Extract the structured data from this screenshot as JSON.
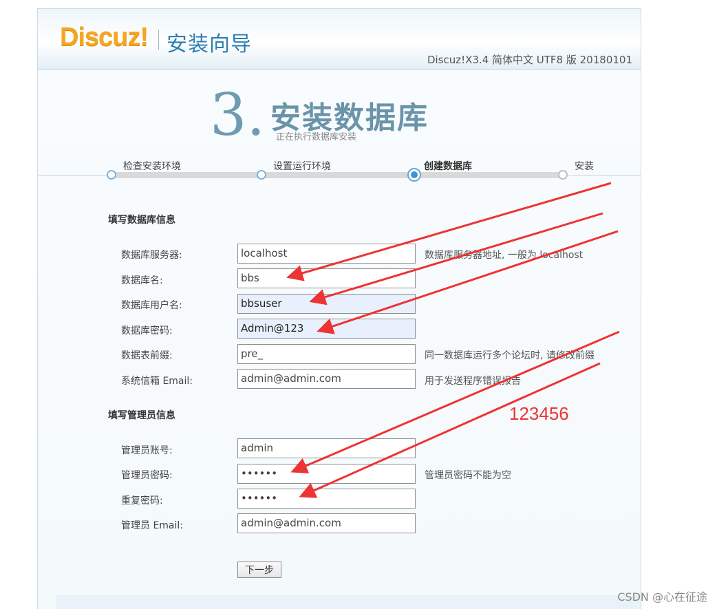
{
  "header": {
    "logo": "Discuz!",
    "title": "安装向导",
    "version": "Discuz!X3.4 简体中文 UTF8 版 20180101"
  },
  "step": {
    "number": "3.",
    "title": "安装数据库",
    "subtitle": "正在执行数据库安装"
  },
  "progress": {
    "steps": [
      "检查安装环境",
      "设置运行环境",
      "创建数据库",
      "安装"
    ],
    "current_index": 2
  },
  "db_section": {
    "title": "填写数据库信息",
    "rows": [
      {
        "label": "数据库服务器:",
        "value": "localhost",
        "hint": "数据库服务器地址, 一般为 localhost"
      },
      {
        "label": "数据库名:",
        "value": "bbs",
        "hint": ""
      },
      {
        "label": "数据库用户名:",
        "value": "bbsuser",
        "hint": ""
      },
      {
        "label": "数据库密码:",
        "value": "Admin@123",
        "hint": ""
      },
      {
        "label": "数据表前缀:",
        "value": "pre_",
        "hint": "同一数据库运行多个论坛时, 请修改前缀"
      },
      {
        "label": "系统信箱 Email:",
        "value": "admin@admin.com",
        "hint": "用于发送程序错误报告"
      }
    ]
  },
  "admin_section": {
    "title": "填写管理员信息",
    "rows": [
      {
        "label": "管理员账号:",
        "value": "admin",
        "hint": ""
      },
      {
        "label": "管理员密码:",
        "value": "••••••",
        "hint": "管理员密码不能为空"
      },
      {
        "label": "重复密码:",
        "value": "••••••",
        "hint": ""
      },
      {
        "label": "管理员 Email:",
        "value": "admin@admin.com",
        "hint": ""
      }
    ]
  },
  "next_button": "下一步",
  "annotation": "123456",
  "watermark": "CSDN @心在征途",
  "colors": {
    "accent": "#2c7fb1",
    "annotation_red": "#ee3333",
    "autofill_bg": "#e8f0fe"
  }
}
